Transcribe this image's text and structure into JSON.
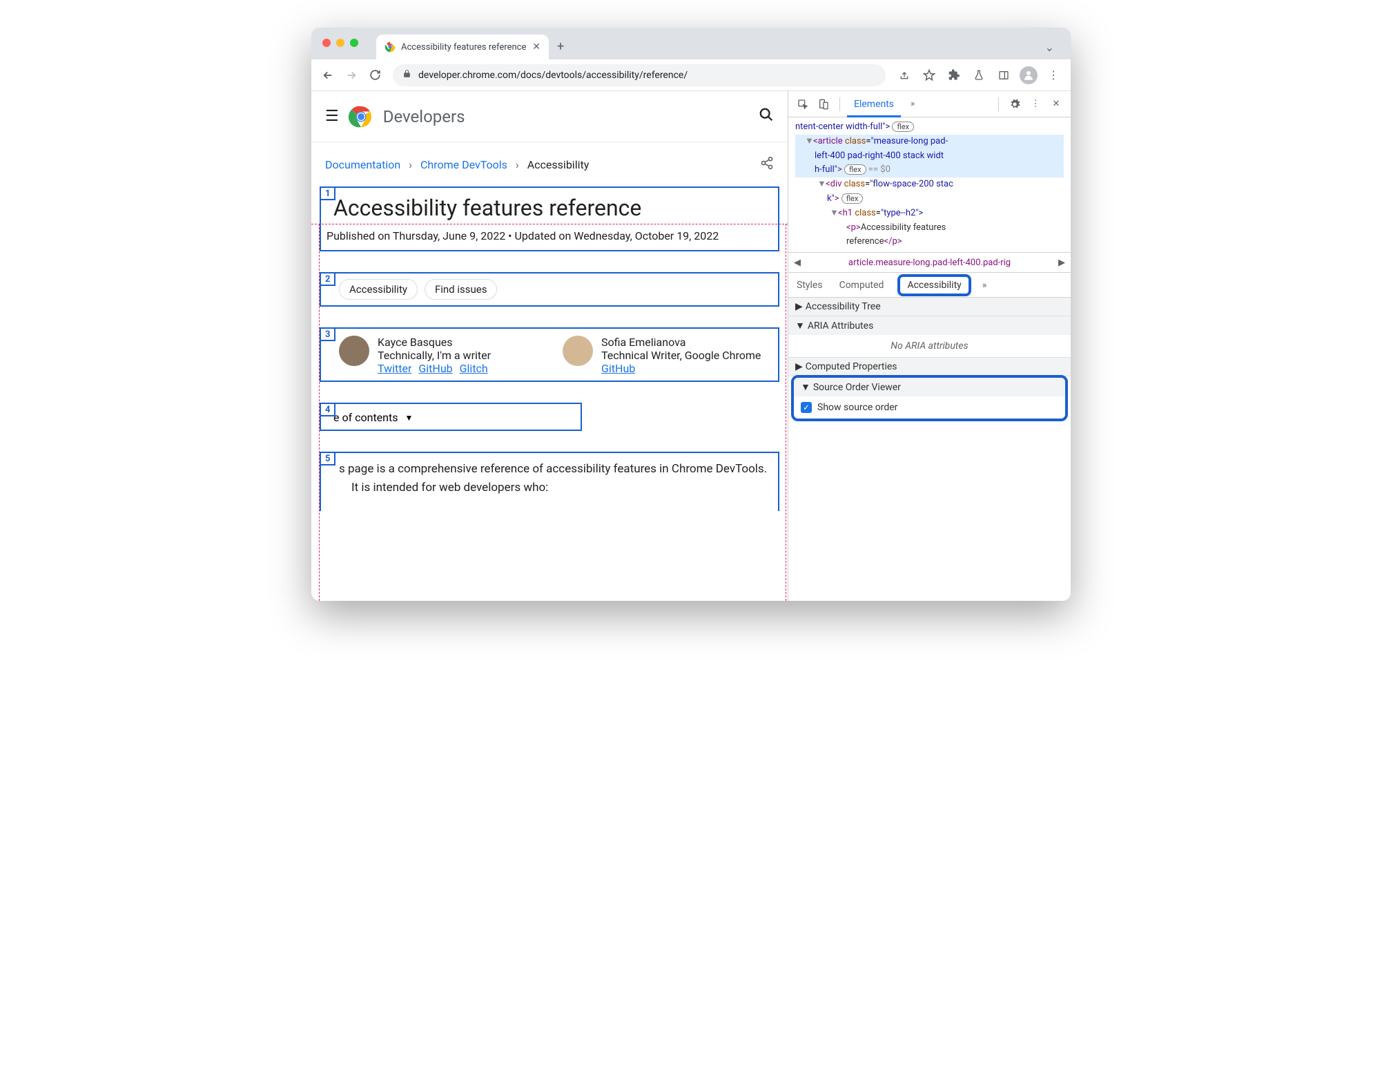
{
  "browser": {
    "tab_title": "Accessibility features reference",
    "url": "developer.chrome.com/docs/devtools/accessibility/reference/"
  },
  "header": {
    "brand": "Developers"
  },
  "breadcrumb": {
    "items": [
      "Documentation",
      "Chrome DevTools",
      "Accessibility"
    ]
  },
  "article": {
    "title": "Accessibility features reference",
    "published": "Published on Thursday, June 9, 2022 • Updated on Wednesday, October 19, 2022",
    "chips": [
      "Accessibility",
      "Find issues"
    ],
    "authors": [
      {
        "name": "Kayce Basques",
        "role": "Technically, I'm a writer",
        "links": [
          "Twitter",
          "GitHub",
          "Glitch"
        ]
      },
      {
        "name": "Sofia Emelianova",
        "role": "Technical Writer, Google Chrome",
        "links": [
          "GitHub"
        ]
      }
    ],
    "toc_label": "e of contents",
    "paragraph": "s page is a comprehensive reference of accessibility features in Chrome DevTools. It is intended for web developers who:",
    "order_labels": [
      "1",
      "2",
      "3",
      "4",
      "5"
    ]
  },
  "devtools": {
    "main_tab": "Elements",
    "dom": {
      "line1_pre": "ntent-center width-full\">",
      "article_open": "<article",
      "article_class": "class",
      "article_classval": "\"measure-long pad-left-400 pad-right-400 stack width-full\">",
      "flex": "flex",
      "eq0": "== $0",
      "div_open": "<div",
      "div_classval": "\"flow-space-200 stack\">",
      "h1_open": "<h1",
      "h1_classval": "\"type--h2\">",
      "p_open": "<p>",
      "p_text": "Accessibility features reference",
      "p_close": "</p>"
    },
    "path": "article.measure-long.pad-left-400.pad-rig",
    "subtabs": [
      "Styles",
      "Computed",
      "Accessibility"
    ],
    "sections": {
      "tree": "Accessibility Tree",
      "aria": "ARIA Attributes",
      "aria_empty": "No ARIA attributes",
      "computed": "Computed Properties",
      "sov": "Source Order Viewer",
      "show_source": "Show source order"
    }
  }
}
